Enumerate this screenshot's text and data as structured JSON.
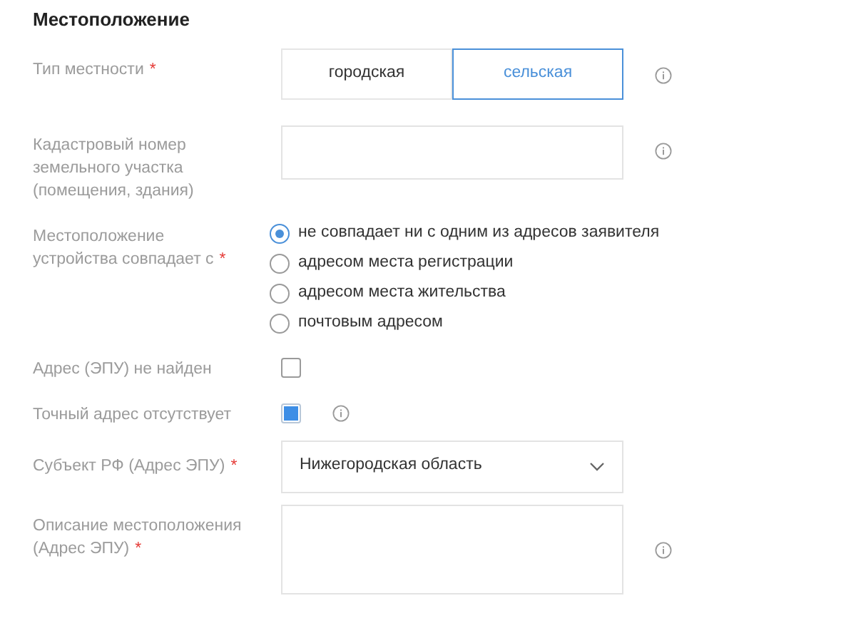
{
  "section_title": "Местоположение",
  "fields": [
    {
      "kind": "segmented",
      "label": "Тип местности",
      "required_mark": "*",
      "info": true,
      "options": [
        {
          "label": "городская",
          "selected": false
        },
        {
          "label": "сельская",
          "selected": true
        }
      ]
    },
    {
      "kind": "text",
      "label": "Кадастровый номер земельного участка (помещения, здания)",
      "info": true
    },
    {
      "kind": "radio",
      "label": "Местоположение устройства совпадает с",
      "required_mark": "*",
      "info": false,
      "options": [
        {
          "label": "не совпадает ни с одним из адресов заявителя",
          "selected": true
        },
        {
          "label": "адресом места регистрации",
          "selected": false
        },
        {
          "label": "адресом места жительства",
          "selected": false
        },
        {
          "label": "почтовым адресом",
          "selected": false
        }
      ]
    },
    {
      "kind": "checkbox",
      "label": "Адрес (ЭПУ) не найден",
      "info": false,
      "checked": false
    },
    {
      "kind": "checkbox",
      "label": "Точный адрес отсутствует",
      "info": true,
      "checked": true
    },
    {
      "kind": "select",
      "label": "Субъект РФ (Адрес ЭПУ)",
      "required_mark": "*",
      "info": false,
      "value": "Нижегородская область"
    },
    {
      "kind": "textarea",
      "label": "Описание местоположения (Адрес ЭПУ)",
      "required_mark": "*",
      "info": true
    }
  ]
}
